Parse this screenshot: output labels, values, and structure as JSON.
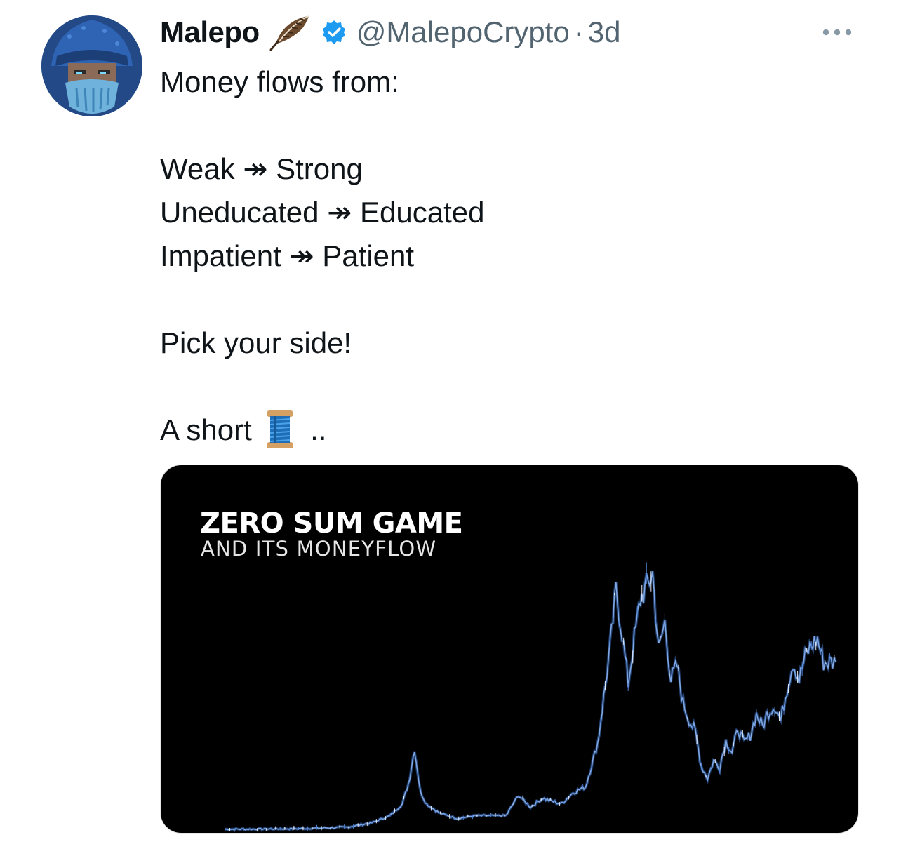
{
  "author": {
    "name": "Malepo",
    "handle": "@MalepoCrypto",
    "separator": "·",
    "time": "3d",
    "avatar_icon": "wizard-avatar",
    "name_emoji_icon": "feather-icon",
    "verified_icon": "verified-badge-icon",
    "verified_color": "#1d9bf0"
  },
  "menu": {
    "icon": "more-options-icon"
  },
  "tweet": {
    "lines": [
      "Money flows from:",
      "Weak ↠ Strong",
      "Uneducated ↠ Educated",
      "Impatient ↠ Patient",
      "Pick your side!",
      "A short",
      ".."
    ],
    "thread_emoji_icon": "spool-of-thread-icon"
  },
  "media": {
    "title": "ZERO SUM GAME",
    "subtitle": "AND ITS MONEYFLOW",
    "background": "#000000",
    "line_color": "#7fa6e0",
    "chart_data": {
      "type": "line",
      "title": "ZERO SUM GAME",
      "subtitle": "AND ITS MONEYFLOW",
      "xlabel": "",
      "ylabel": "",
      "grid": false,
      "ylim": [
        0,
        100
      ],
      "x": [
        0,
        4,
        8,
        12,
        16,
        20,
        24,
        27,
        29,
        30,
        31,
        32,
        33,
        35,
        38,
        41,
        44,
        46,
        48,
        50,
        52,
        55,
        57,
        59,
        61,
        63,
        64,
        65,
        66,
        67,
        68,
        69,
        70,
        71,
        72,
        73,
        74,
        75,
        76,
        77,
        78,
        79,
        80,
        81,
        82,
        83,
        84,
        85,
        86,
        87,
        88,
        89,
        90,
        91,
        92,
        93,
        94,
        95,
        96,
        97,
        98,
        100
      ],
      "values": [
        0.3,
        0.3,
        0.4,
        0.5,
        0.7,
        1,
        2.5,
        5,
        9,
        16,
        28,
        13,
        9,
        6,
        4,
        5,
        5,
        5,
        12,
        8,
        11,
        9,
        13,
        15,
        30,
        62,
        83,
        68,
        51,
        66,
        80,
        84,
        89,
        62,
        72,
        52,
        57,
        44,
        38,
        34,
        22,
        18,
        24,
        22,
        31,
        27,
        35,
        30,
        33,
        40,
        36,
        41,
        43,
        38,
        49,
        58,
        52,
        60,
        64,
        66,
        58,
        58
      ]
    }
  }
}
